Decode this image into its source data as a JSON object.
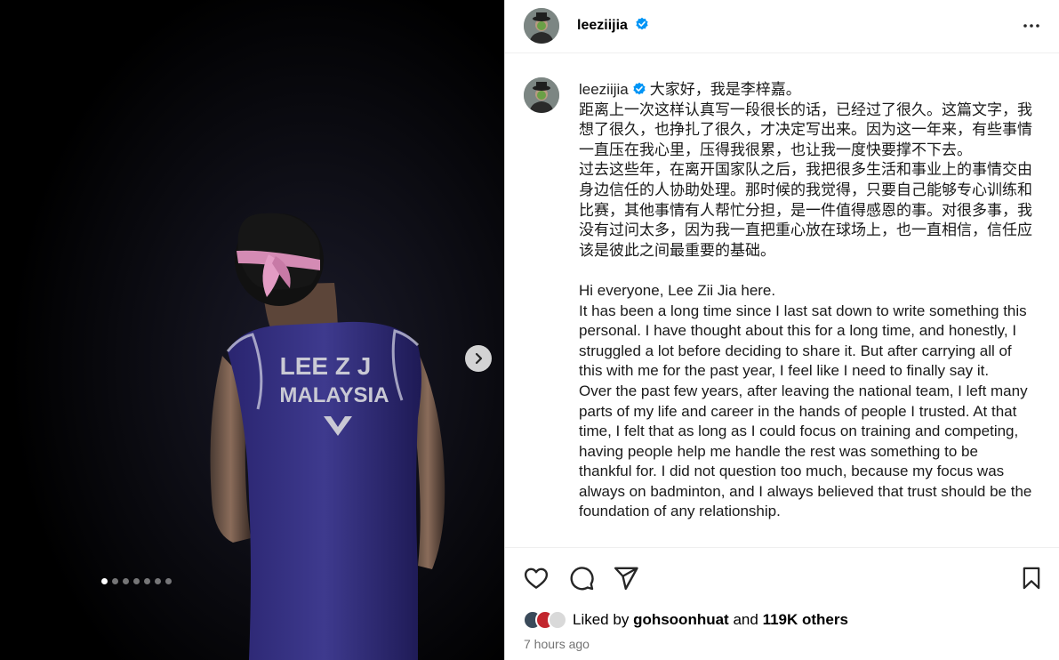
{
  "post": {
    "username": "leeziijia",
    "verified": true,
    "carousel": {
      "total": 7,
      "current": 1
    },
    "jersey_text": [
      "LEE Z J",
      "MALAYSIA"
    ]
  },
  "caption": {
    "username": "leeziijia",
    "lines": [
      "大家好，我是李梓嘉。",
      "距离上一次这样认真写一段很长的话，已经过了很久。这篇文字，我想了很久，也挣扎了很久，才决定写出来。因为这一年来，有些事情一直压在我心里，压得我很累，也让我一度快要撑不下去。",
      "过去这些年，在离开国家队之后，我把很多生活和事业上的事情交由身边信任的人协助处理。那时候的我觉得，只要自己能够专心训练和比赛，其他事情有人帮忙分担，是一件值得感恩的事。对很多事，我没有过问太多，因为我一直把重心放在球场上，也一直相信，信任应该是彼此之间最重要的基础。",
      "",
      "Hi everyone, Lee Zii Jia here.",
      "It has been a long time since I last sat down to write something this personal. I have thought about this for a long time, and honestly, I struggled a lot before deciding to share it. But after carrying all of this with me for the past year, I feel like I need to finally say it.",
      "Over the past few years, after leaving the national team, I left many parts of my life and career in the hands of people I trusted. At that time, I felt that as long as I could focus on training and competing, having people help me handle the rest was something to be thankful for. I did not question too much, because my focus was always on badminton, and I always believed that trust should be the foundation of any relationship."
    ]
  },
  "likes": {
    "prefix": "Liked by",
    "user": "gohsoonhuat",
    "conjunction": "and",
    "others": "119K others"
  },
  "timestamp": "7 hours ago",
  "colors": {
    "verified": "#0095f6",
    "muted": "#737373"
  }
}
